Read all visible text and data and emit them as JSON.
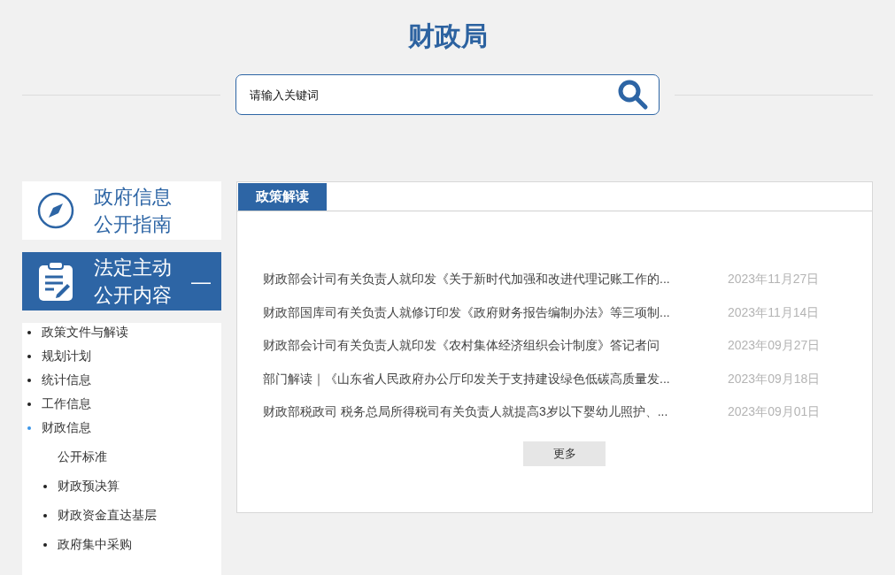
{
  "site_title": "财政局",
  "search": {
    "placeholder": "请输入关键词"
  },
  "sidebar": {
    "cards": [
      {
        "kind": "guide",
        "title_lines": [
          "政府信息",
          "公开指南"
        ],
        "selected": false
      },
      {
        "kind": "content",
        "title_lines": [
          "法定主动",
          "公开内容"
        ],
        "selected": true,
        "expanded": true,
        "toggle": "—"
      }
    ],
    "items": [
      {
        "label": "政策文件与解读",
        "selected": false
      },
      {
        "label": "规划计划",
        "selected": false
      },
      {
        "label": "统计信息",
        "selected": false
      },
      {
        "label": "工作信息",
        "selected": false
      },
      {
        "label": "财政信息",
        "selected": true,
        "children": [
          {
            "label": "公开标准",
            "bullet": false
          },
          {
            "label": "财政预决算",
            "bullet": true
          },
          {
            "label": "财政资金直达基层",
            "bullet": true
          },
          {
            "label": "政府集中采购",
            "bullet": true
          }
        ]
      }
    ]
  },
  "panel": {
    "tab": "政策解读",
    "articles": [
      {
        "title": "财政部会计司有关负责人就印发《关于新时代加强和改进代理记账工作的...",
        "date": "2023年11月27日"
      },
      {
        "title": "财政部国库司有关负责人就修订印发《政府财务报告编制办法》等三项制...",
        "date": "2023年11月14日"
      },
      {
        "title": "财政部会计司有关负责人就印发《农村集体经济组织会计制度》答记者问",
        "date": "2023年09月27日"
      },
      {
        "title": "部门解读｜《山东省人民政府办公厅印发关于支持建设绿色低碳高质量发...",
        "date": "2023年09月18日"
      },
      {
        "title": "财政部税政司 税务总局所得税司有关负责人就提高3岁以下婴幼儿照护、...",
        "date": "2023年09月01日"
      }
    ],
    "more": "更多"
  }
}
